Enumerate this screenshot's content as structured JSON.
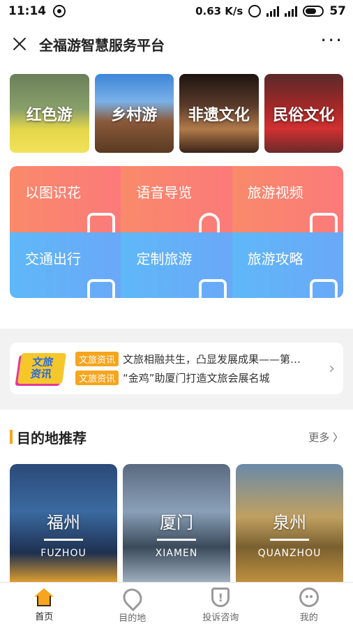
{
  "status": {
    "time": "11:14",
    "speed": "0.63 K/s",
    "battery": "57"
  },
  "nav": {
    "title": "全福游智慧服务平台",
    "more": "···"
  },
  "categories": [
    {
      "label": "红色游"
    },
    {
      "label": "乡村游"
    },
    {
      "label": "非遗文化"
    },
    {
      "label": "民俗文化"
    }
  ],
  "services": [
    {
      "label": "以图识花"
    },
    {
      "label": "语音导览"
    },
    {
      "label": "旅游视频"
    },
    {
      "label": "交通出行"
    },
    {
      "label": "定制旅游"
    },
    {
      "label": "旅游攻略"
    }
  ],
  "news": {
    "logo_line1": "文旅",
    "logo_line2": "资讯",
    "items": [
      {
        "tag": "文旅资讯",
        "text": "文旅相融共生，凸显发展成果——第…"
      },
      {
        "tag": "文旅资讯",
        "text": "“金鸡”助厦门打造文旅会展名城"
      }
    ],
    "chevron": "›"
  },
  "destinations": {
    "title": "目的地推荐",
    "more": "更多 〉",
    "cities": [
      {
        "name": "福州",
        "en": "FUZHOU"
      },
      {
        "name": "厦门",
        "en": "XIAMEN"
      },
      {
        "name": "泉州",
        "en": "QUANZHOU"
      }
    ]
  },
  "tabs": [
    {
      "label": "首页"
    },
    {
      "label": "目的地"
    },
    {
      "label": "投诉咨询"
    },
    {
      "label": "我的"
    }
  ]
}
